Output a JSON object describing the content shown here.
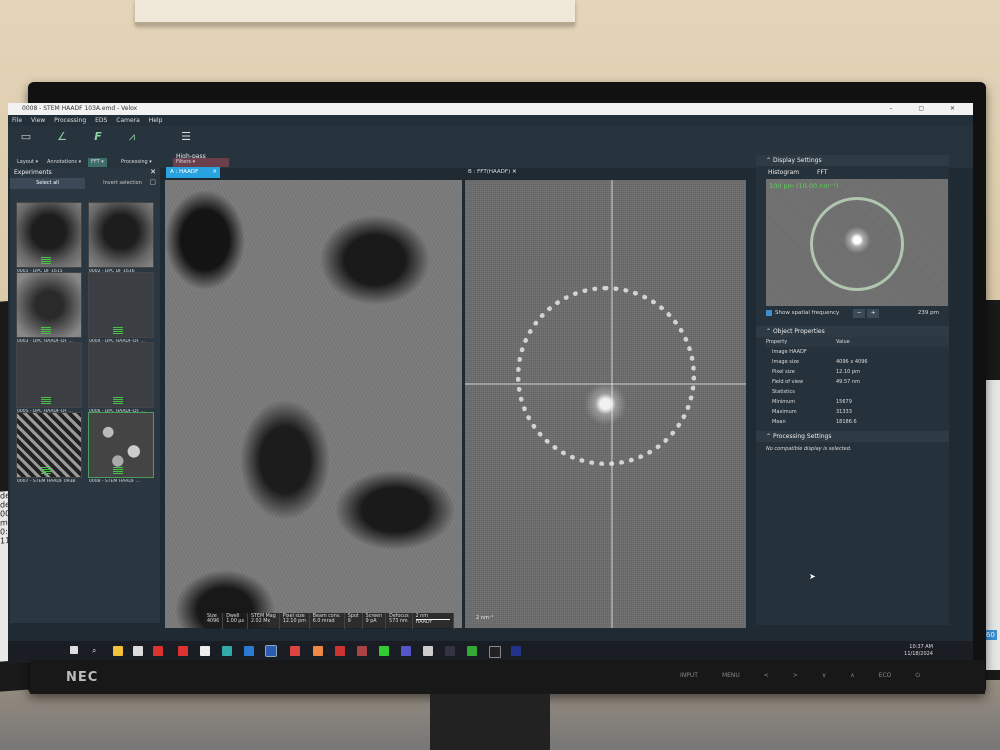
{
  "window": {
    "title": "0008 - STEM HAADF 103A.emd - Velox"
  },
  "menu": [
    "File",
    "View",
    "Processing",
    "EDS",
    "Camera",
    "Help"
  ],
  "ribbon": {
    "layout": "Layout ▾",
    "annotations": "Annotations ▾",
    "fft": "FFT ▾",
    "processing": "Processing ▾",
    "filters": "Filters ▾",
    "highpass": "High-pass"
  },
  "experiments": {
    "title": "Experiments",
    "select_all": "Select all",
    "invert_selection": "Invert selection",
    "items": [
      "0001 - DPC DF 1615",
      "0002 - DPC DF 1616",
      "0003 - DPC HAADF-DF ...",
      "0004 - DPC HAADF-DF ...",
      "0005 - DPC HAADF-DF ...",
      "0006 - DPC HAADF-DF ...",
      "0007 - STEM HAADF 0938",
      "0008 - STEM HAADF ..."
    ]
  },
  "tabs": {
    "a": "A : HAADF",
    "b": "B : FFT(HAADF)"
  },
  "infobar": [
    {
      "k": "Size",
      "v": "4096"
    },
    {
      "k": "Dwell",
      "v": "1.00 µs"
    },
    {
      "k": "STEM Mag",
      "v": "2.02 Mx"
    },
    {
      "k": "Pixel size",
      "v": "12.10 pm"
    },
    {
      "k": "Beam conv.",
      "v": "6.0 mrad"
    },
    {
      "k": "Spot",
      "v": "9"
    },
    {
      "k": "Screen",
      "v": "9 pA"
    },
    {
      "k": "Defocus",
      "v": "573 nm"
    },
    {
      "k": "2 nm",
      "v": "HAADF"
    }
  ],
  "fft_scale": "2 nm⁻¹",
  "display_settings": {
    "title": "Display Settings",
    "tab1": "Histogram",
    "tab2": "FFT",
    "fft_label": "100 pm (10.00 nm⁻¹)",
    "show_spatial": "Show spatial frequency",
    "minus": "−",
    "plus": "+",
    "value": "239 pm"
  },
  "object_properties": {
    "title": "Object Properties",
    "col1": "Property",
    "col2": "Value",
    "rows": [
      {
        "k": "Image HAADF",
        "v": ""
      },
      {
        "k": "Image size",
        "v": "4096 x 4096"
      },
      {
        "k": "Pixel size",
        "v": "12.10 pm"
      },
      {
        "k": "Field of view",
        "v": "49.57 nm"
      },
      {
        "k": "Statistics",
        "v": ""
      },
      {
        "k": "Minimum",
        "v": "15679"
      },
      {
        "k": "Maximum",
        "v": "31333"
      },
      {
        "k": "Mean",
        "v": "18186.6"
      }
    ]
  },
  "processing_settings": {
    "title": "Processing Settings",
    "message": "No compatible display is selected."
  },
  "clock": {
    "time": "10:37 AM",
    "date": "11/18/2024"
  },
  "bezel": {
    "brand": "NEC",
    "buttons": [
      "INPUT",
      "MENU",
      "<",
      ">",
      "∨",
      "∧",
      "ECO",
      "⏻"
    ]
  },
  "left_monitor": {
    "lines": [
      "deg",
      "deg",
      "00 nm",
      "mrad",
      "0:37 AM",
      "11/18/2024"
    ]
  },
  "right_monitor": {
    "size_label": "Size: 5760"
  }
}
